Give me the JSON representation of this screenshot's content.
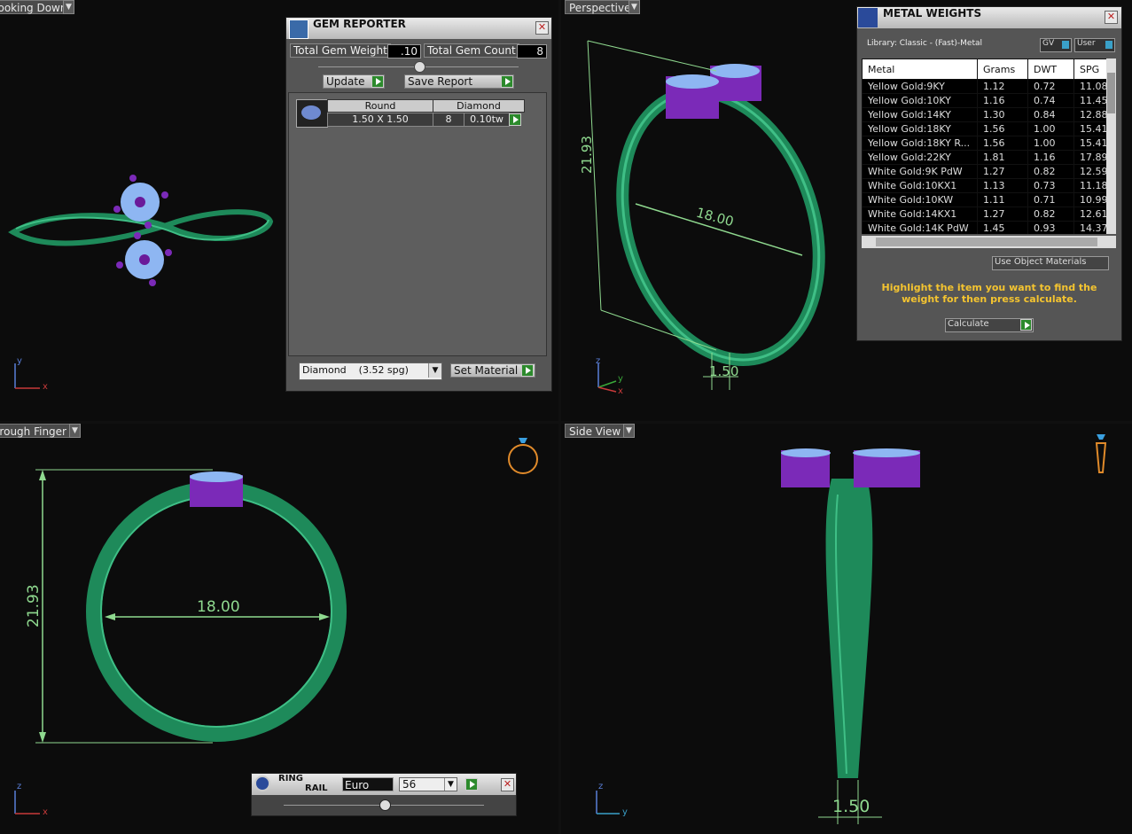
{
  "viewports": {
    "top_left": {
      "label": "Looking Down",
      "axes": [
        "y",
        "x"
      ]
    },
    "top_right": {
      "label": "Perspective",
      "axes": [
        "z",
        "y",
        "x"
      ],
      "dims": {
        "height": "21.93",
        "inner": "18.00",
        "width": "1.50"
      }
    },
    "bottom_left": {
      "label": "Through Finger",
      "axes": [
        "z",
        "x"
      ],
      "dims": {
        "height": "21.93",
        "inner": "18.00"
      }
    },
    "bottom_right": {
      "label": "Side View",
      "axes": [
        "z",
        "y"
      ],
      "dims": {
        "width": "1.50"
      }
    }
  },
  "gem_reporter": {
    "title": "GEM REPORTER",
    "total_gem_weight_label": "Total Gem Weight",
    "total_gem_weight": ".10",
    "total_gem_count_label": "Total Gem Count",
    "total_gem_count": "8",
    "update_label": "Update",
    "save_report_label": "Save Report",
    "table_headers": [
      "Round",
      "Diamond"
    ],
    "row": {
      "size": "1.50 X 1.50",
      "count": "8",
      "weight": "0.10tw"
    },
    "material_select": "Diamond    (3.52 spg)",
    "set_material_label": "Set Material"
  },
  "metal_weights": {
    "title": "METAL WEIGHTS",
    "library": "Library: Classic - (Fast)-Metal",
    "gv_label": "GV",
    "user_label": "User",
    "headers": [
      "Metal",
      "Grams",
      "DWT",
      "SPG"
    ],
    "rows": [
      [
        "Yellow Gold:9KY",
        "1.12",
        "0.72",
        "11.08"
      ],
      [
        "Yellow Gold:10KY",
        "1.16",
        "0.74",
        "11.45"
      ],
      [
        "Yellow Gold:14KY",
        "1.30",
        "0.84",
        "12.88"
      ],
      [
        "Yellow Gold:18KY",
        "1.56",
        "1.00",
        "15.41"
      ],
      [
        "Yellow Gold:18KY R...",
        "1.56",
        "1.00",
        "15.41"
      ],
      [
        "Yellow Gold:22KY",
        "1.81",
        "1.16",
        "17.89"
      ],
      [
        "White Gold:9K PdW",
        "1.27",
        "0.82",
        "12.59"
      ],
      [
        "White Gold:10KX1",
        "1.13",
        "0.73",
        "11.18"
      ],
      [
        "White Gold:10KW",
        "1.11",
        "0.71",
        "10.99"
      ],
      [
        "White Gold:14KX1",
        "1.27",
        "0.82",
        "12.61"
      ],
      [
        "White Gold:14K PdW",
        "1.45",
        "0.93",
        "14.37"
      ]
    ],
    "use_object_materials": "Use Object Materials",
    "instruction": "Highlight the item you want to find the weight for then press calculate.",
    "calculate_label": "Calculate"
  },
  "ring_rail": {
    "title_line1": "RING",
    "title_line2": "RAIL",
    "standard": "Euro",
    "size": "56"
  },
  "colors": {
    "ring": "#1e8a5a",
    "gem_setting": "#8a3ac8",
    "dimension": "#8fd98f",
    "instruction": "#f4c430"
  }
}
